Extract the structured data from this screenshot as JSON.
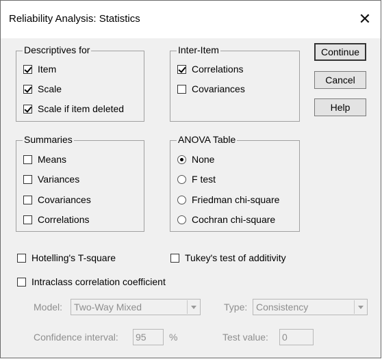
{
  "window": {
    "title": "Reliability Analysis: Statistics",
    "close_glyph": "✕"
  },
  "descriptives": {
    "label": "Descriptives for",
    "items": [
      {
        "label": "Item",
        "checked": true
      },
      {
        "label": "Scale",
        "checked": true
      },
      {
        "label": "Scale if item deleted",
        "checked": true
      }
    ]
  },
  "inter_item": {
    "label": "Inter-Item",
    "items": [
      {
        "label": "Correlations",
        "checked": true
      },
      {
        "label": "Covariances",
        "checked": false
      }
    ]
  },
  "summaries": {
    "label": "Summaries",
    "items": [
      {
        "label": "Means",
        "checked": false
      },
      {
        "label": "Variances",
        "checked": false
      },
      {
        "label": "Covariances",
        "checked": false
      },
      {
        "label": "Correlations",
        "checked": false
      }
    ]
  },
  "anova": {
    "label": "ANOVA Table",
    "options": [
      {
        "label": "None",
        "selected": true
      },
      {
        "label": "F test",
        "selected": false
      },
      {
        "label": "Friedman chi-square",
        "selected": false
      },
      {
        "label": "Cochran chi-square",
        "selected": false
      }
    ]
  },
  "buttons": {
    "continue": "Continue",
    "cancel": "Cancel",
    "help": "Help"
  },
  "options": {
    "hotelling": {
      "label": "Hotelling's T-square",
      "checked": false
    },
    "tukey": {
      "label": "Tukey's test of additivity",
      "checked": false
    },
    "icc": {
      "label": "Intraclass correlation coefficient",
      "checked": false
    }
  },
  "icc": {
    "model_label": "Model:",
    "model_value": "Two-Way Mixed",
    "type_label": "Type:",
    "type_value": "Consistency",
    "ci_label": "Confidence interval:",
    "ci_value": "95",
    "ci_unit": "%",
    "test_label": "Test value:",
    "test_value": "0"
  }
}
